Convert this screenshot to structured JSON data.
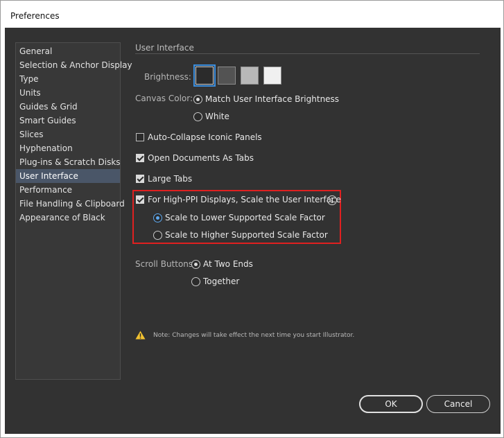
{
  "window": {
    "title": "Preferences"
  },
  "sidebar": {
    "items": [
      {
        "label": "General"
      },
      {
        "label": "Selection & Anchor Display"
      },
      {
        "label": "Type"
      },
      {
        "label": "Units"
      },
      {
        "label": "Guides & Grid"
      },
      {
        "label": "Smart Guides"
      },
      {
        "label": "Slices"
      },
      {
        "label": "Hyphenation"
      },
      {
        "label": "Plug-ins & Scratch Disks"
      },
      {
        "label": "User Interface",
        "selected": true
      },
      {
        "label": "Performance"
      },
      {
        "label": "File Handling & Clipboard"
      },
      {
        "label": "Appearance of Black"
      }
    ]
  },
  "main": {
    "section_title": "User Interface",
    "brightness": {
      "label": "Brightness:",
      "swatches": [
        "#2b2b2b",
        "#535353",
        "#b8b8b8",
        "#f0f0f0"
      ],
      "selected_index": 0
    },
    "canvas_color": {
      "label": "Canvas Color:",
      "options": [
        "Match User Interface Brightness",
        "White"
      ],
      "selected": "Match User Interface Brightness"
    },
    "checkboxes": {
      "auto_collapse": {
        "label": "Auto-Collapse Iconic Panels",
        "checked": false
      },
      "open_docs_tabs": {
        "label": "Open Documents As Tabs",
        "checked": true
      },
      "large_tabs": {
        "label": "Large Tabs",
        "checked": true
      },
      "high_ppi": {
        "label": "For High-PPI Displays, Scale the User Interface",
        "checked": true
      }
    },
    "scale_options": {
      "lower": "Scale to Lower Supported Scale Factor",
      "higher": "Scale to Higher Supported Scale Factor",
      "selected": "Scale to Lower Supported Scale Factor"
    },
    "scroll_buttons": {
      "label": "Scroll Buttons:",
      "options": [
        "At Two Ends",
        "Together"
      ],
      "selected": "At Two Ends"
    },
    "note": "Note:  Changes will take effect the next time you start Illustrator."
  },
  "buttons": {
    "ok": "OK",
    "cancel": "Cancel"
  },
  "colors": {
    "panel_bg": "#323232",
    "selection": "#4a5668",
    "highlight_box": "#e02020",
    "focus_blue": "#3b8fe0",
    "warning": "#f2c230"
  }
}
